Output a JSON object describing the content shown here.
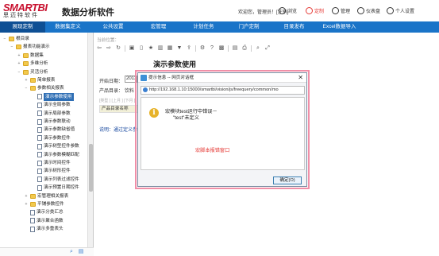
{
  "header": {
    "logo_main": "SMARTBI",
    "logo_sub": "思迈特软件",
    "app_title": "数据分析软件",
    "welcome": "欢迎您，管理员！[注销]",
    "items": [
      {
        "label": "浏览",
        "icon": "eye-icon",
        "color": "#333333"
      },
      {
        "label": "定制",
        "icon": "pen-icon",
        "color": "#e53935"
      },
      {
        "label": "管理",
        "icon": "monitor-icon",
        "color": "#333333"
      },
      {
        "label": "仪表盘",
        "icon": "gauge-icon",
        "color": "#333333"
      },
      {
        "label": "个人设置",
        "icon": "user-icon",
        "color": "#333333"
      }
    ]
  },
  "menu": [
    "展现定制",
    "数据集定义",
    "公共设置",
    "宏管理",
    "计划任务",
    "门户定制",
    "目录发布",
    "Excel数据导入"
  ],
  "tree": [
    {
      "label": "根目录",
      "indent": 0,
      "type": "folder",
      "toggle": "−"
    },
    {
      "label": "报表功能演示",
      "indent": 1,
      "type": "folder",
      "toggle": "−"
    },
    {
      "label": "数据集",
      "indent": 2,
      "type": "folder",
      "toggle": "+"
    },
    {
      "label": "多维分析",
      "indent": 2,
      "type": "folder",
      "toggle": "+"
    },
    {
      "label": "灵活分析",
      "indent": 2,
      "type": "folder",
      "toggle": "−"
    },
    {
      "label": "简单报表",
      "indent": 3,
      "type": "folder",
      "toggle": "+"
    },
    {
      "label": "参数相关报表",
      "indent": 3,
      "type": "folder",
      "toggle": "−"
    },
    {
      "label": "演示参数使用",
      "indent": 4,
      "type": "page",
      "toggle": "",
      "selected": true
    },
    {
      "label": "演示全局参数",
      "indent": 4,
      "type": "page",
      "toggle": ""
    },
    {
      "label": "演示局部参数",
      "indent": 4,
      "type": "page",
      "toggle": ""
    },
    {
      "label": "演示参数联动",
      "indent": 4,
      "type": "page",
      "toggle": ""
    },
    {
      "label": "演示参数缺省值",
      "indent": 4,
      "type": "page",
      "toggle": ""
    },
    {
      "label": "演示参数控件",
      "indent": 4,
      "type": "page",
      "toggle": ""
    },
    {
      "label": "演示树型控件参数",
      "indent": 4,
      "type": "page",
      "toggle": ""
    },
    {
      "label": "演示参数模糊匹配",
      "indent": 4,
      "type": "page",
      "toggle": ""
    },
    {
      "label": "演示时间控件",
      "indent": 4,
      "type": "page",
      "toggle": ""
    },
    {
      "label": "演示树形控件",
      "indent": 4,
      "type": "page",
      "toggle": ""
    },
    {
      "label": "演示列表过滤控件",
      "indent": 4,
      "type": "page",
      "toggle": ""
    },
    {
      "label": "演示预置日期控件",
      "indent": 4,
      "type": "page",
      "toggle": ""
    },
    {
      "label": "宏管理相关报表",
      "indent": 3,
      "type": "folder",
      "toggle": "+"
    },
    {
      "label": "平铺参数控件",
      "indent": 3,
      "type": "folder",
      "toggle": "+"
    },
    {
      "label": "演示分类汇总",
      "indent": 3,
      "type": "page",
      "toggle": ""
    },
    {
      "label": "演示聚合函数",
      "indent": 3,
      "type": "page",
      "toggle": ""
    },
    {
      "label": "演示多重表头",
      "indent": 3,
      "type": "page",
      "toggle": ""
    }
  ],
  "content": {
    "crumb": "当前位置：",
    "report_title": "演示参数使用",
    "param1_label": "开始日期：",
    "param1_value": "2013",
    "param2_label": "产品目录：",
    "param2_value": "饮料",
    "grey_note": "[类型 ] [上月 ] [下月 ]",
    "field_label": "产品目录名称",
    "note": "说明：通过定义参数"
  },
  "dialog": {
    "title": "提示信息 -- 网页对话框",
    "close": "✕",
    "url": "http://192.168.1.10:15000/smartbi/vision/js/freequery/common/mo",
    "msg1": "宏模块test运行中错误－",
    "msg2": "\"test\"未定义",
    "red_note": "宏脚本报错窗口",
    "ok": "确定(O)"
  },
  "colors": {
    "accent": "#1a74c8",
    "active": "#0e4f94",
    "brand": "#c8102e",
    "highlight": "#f08fa8"
  }
}
